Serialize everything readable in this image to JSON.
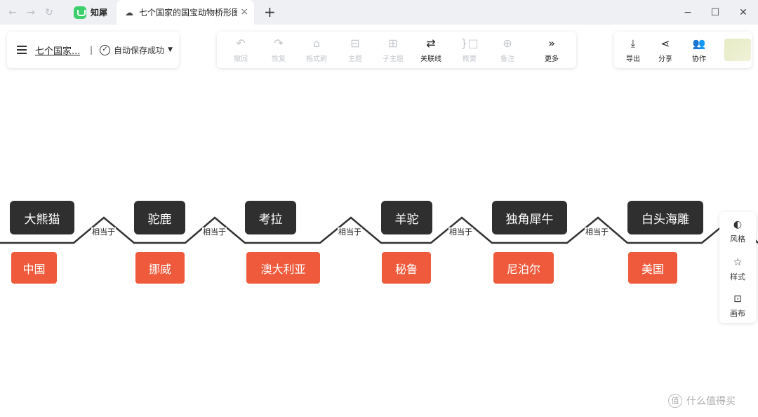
{
  "browser": {
    "tabs": [
      {
        "title": "知犀"
      },
      {
        "title": "七个国家的国宝动物桥形图_新"
      }
    ],
    "new_tab_symbol": "+",
    "close_symbol": "×"
  },
  "document": {
    "title": "七个国家...",
    "separator": "|",
    "save_status": "自动保存成功"
  },
  "toolbar": {
    "items": [
      {
        "label": "撤回",
        "icon": "undo-icon",
        "glyph": "↶",
        "enabled": false
      },
      {
        "label": "恢复",
        "icon": "redo-icon",
        "glyph": "↷",
        "enabled": false
      },
      {
        "label": "格式刷",
        "icon": "format-brush-icon",
        "glyph": "⌂",
        "enabled": false
      },
      {
        "label": "主题",
        "icon": "topic-icon",
        "glyph": "⊟",
        "enabled": false
      },
      {
        "label": "子主题",
        "icon": "subtopic-icon",
        "glyph": "⊞",
        "enabled": false
      },
      {
        "label": "关联线",
        "icon": "relation-line-icon",
        "glyph": "⇄",
        "enabled": true
      },
      {
        "label": "概要",
        "icon": "summary-icon",
        "glyph": "}□",
        "enabled": false
      },
      {
        "label": "备注",
        "icon": "note-icon",
        "glyph": "⊕",
        "enabled": false
      },
      {
        "label": "更多",
        "icon": "more-icon",
        "glyph": "»",
        "enabled": true
      }
    ],
    "right": [
      {
        "label": "导出",
        "icon": "export-icon",
        "glyph": "⤓"
      },
      {
        "label": "分享",
        "icon": "share-icon",
        "glyph": "⋖"
      },
      {
        "label": "协作",
        "icon": "collaborate-icon",
        "glyph": "👥"
      }
    ]
  },
  "bridge": {
    "relation_label": "相当于",
    "pairs": [
      {
        "animal": "大熊猫",
        "country": "中国"
      },
      {
        "animal": "驼鹿",
        "country": "挪威"
      },
      {
        "animal": "考拉",
        "country": "澳大利亚"
      },
      {
        "animal": "羊驼",
        "country": "秘鲁"
      },
      {
        "animal": "独角犀牛",
        "country": "尼泊尔"
      },
      {
        "animal": "白头海雕",
        "country": "美国"
      }
    ]
  },
  "side_panel": {
    "items": [
      {
        "label": "风格",
        "icon": "palette-icon",
        "glyph": "◐"
      },
      {
        "label": "样式",
        "icon": "style-icon",
        "glyph": "☆"
      },
      {
        "label": "画布",
        "icon": "canvas-icon",
        "glyph": "⊡"
      }
    ]
  },
  "watermark": {
    "text": "什么值得买",
    "glyph": "值"
  },
  "colors": {
    "animal_node": "#2f2f2f",
    "country_node": "#f05a3c",
    "line": "#333333"
  }
}
